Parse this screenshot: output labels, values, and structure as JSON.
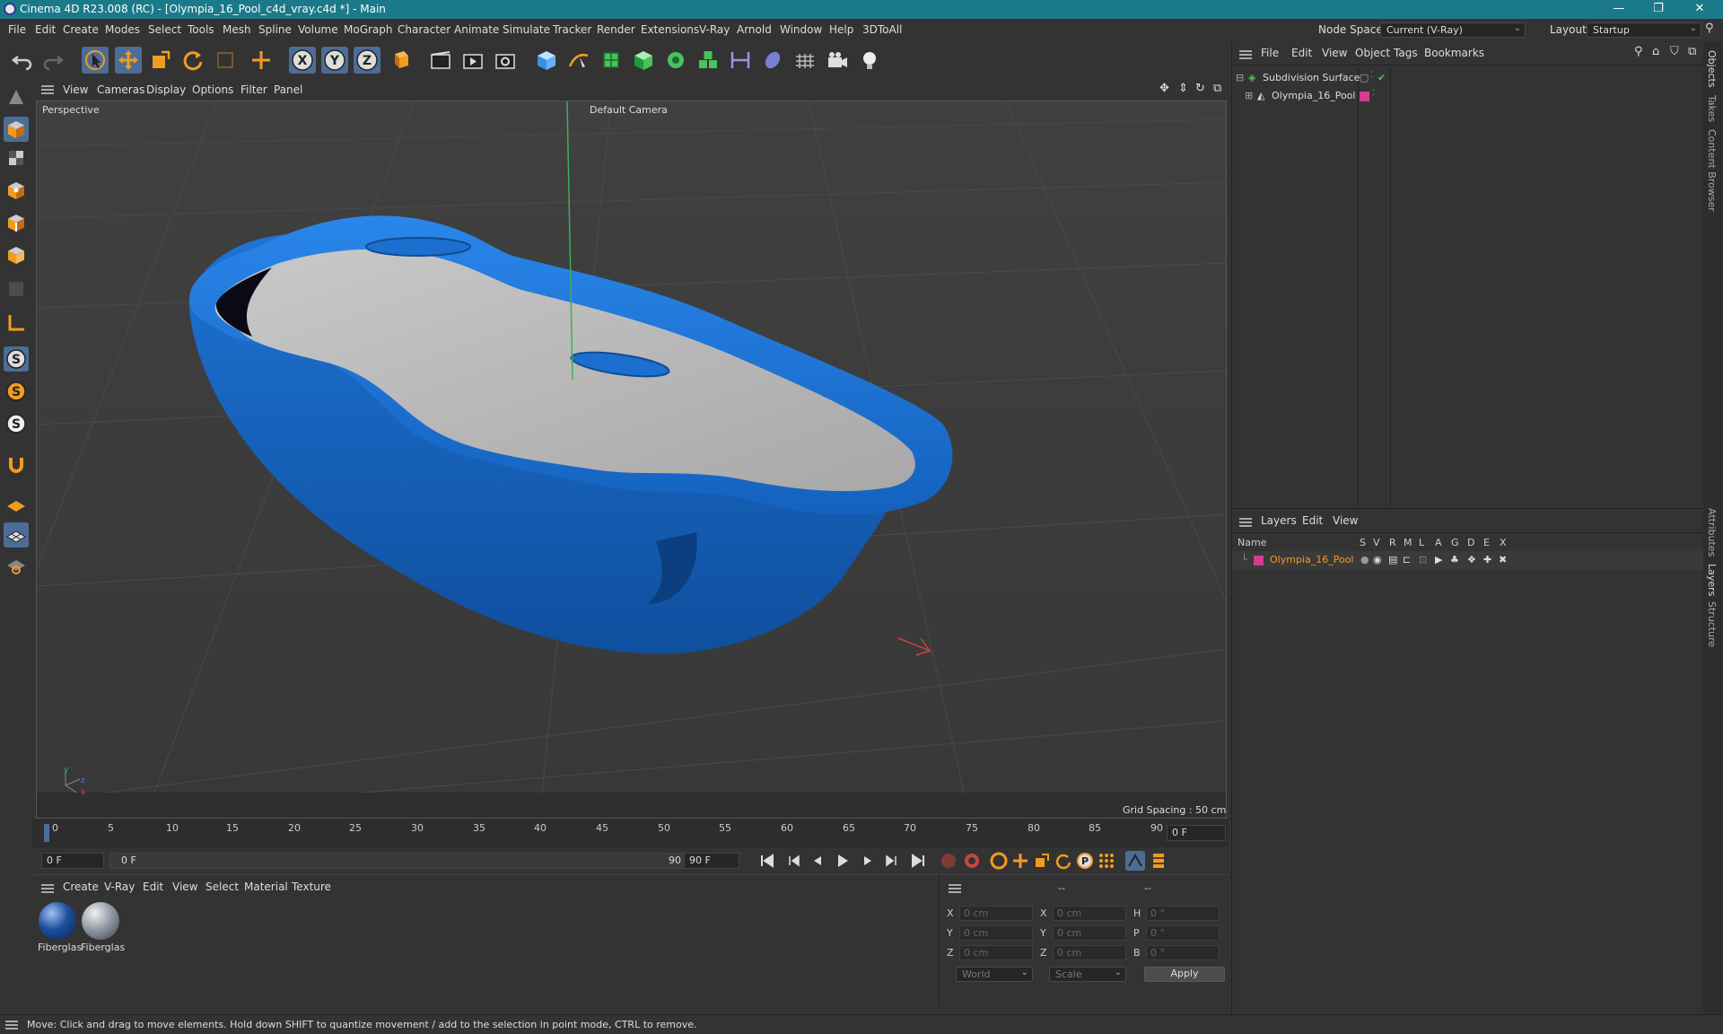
{
  "window": {
    "title": "Cinema 4D R23.008 (RC) - [Olympia_16_Pool_c4d_vray.c4d *] - Main",
    "controls": [
      "—",
      "❐",
      "✕"
    ]
  },
  "menubar": {
    "items": [
      "File",
      "Edit",
      "Create",
      "Modes",
      "Select",
      "Tools",
      "Mesh",
      "Spline",
      "Volume",
      "MoGraph",
      "Character",
      "Animate",
      "Simulate",
      "Tracker",
      "Render",
      "Extensions",
      "V-Ray",
      "Arnold",
      "Window",
      "Help",
      "3DToAll"
    ],
    "node_space_label": "Node Space:",
    "node_space_value": "Current (V-Ray)",
    "layout_label": "Layout:",
    "layout_value": "Startup"
  },
  "viewport": {
    "menu": [
      "View",
      "Cameras",
      "Display",
      "Options",
      "Filter",
      "Panel"
    ],
    "view_name": "Perspective",
    "camera_name": "Default Camera",
    "grid_spacing": "Grid Spacing : 50 cm",
    "axis_labels": {
      "y": "y",
      "z": "z",
      "x": "x"
    }
  },
  "timeline": {
    "ticks": [
      "0",
      "5",
      "10",
      "15",
      "20",
      "25",
      "30",
      "35",
      "40",
      "45",
      "50",
      "55",
      "60",
      "65",
      "70",
      "75",
      "80",
      "85",
      "90"
    ],
    "current_frame_right": "0 F",
    "start_field": "0 F",
    "range_start": "0 F",
    "range_end": "90 F",
    "end_field": "90 F"
  },
  "materials": {
    "menu": [
      "Create",
      "V-Ray",
      "Edit",
      "View",
      "Select",
      "Material",
      "Texture"
    ],
    "items": [
      {
        "label": "Fiberglas",
        "color": "#1d4f9c"
      },
      {
        "label": "Fiberglas",
        "color": "#8a93a0"
      }
    ]
  },
  "attributes": {
    "headers": [
      "--",
      "--",
      "--"
    ],
    "rows": [
      {
        "l1": "X",
        "v1": "0 cm",
        "l2": "X",
        "v2": "0 cm",
        "l3": "H",
        "v3": "0 °"
      },
      {
        "l1": "Y",
        "v1": "0 cm",
        "l2": "Y",
        "v2": "0 cm",
        "l3": "P",
        "v3": "0 °"
      },
      {
        "l1": "Z",
        "v1": "0 cm",
        "l2": "Z",
        "v2": "0 cm",
        "l3": "B",
        "v3": "0 °"
      }
    ],
    "coord_system": "World",
    "mode": "Scale",
    "apply": "Apply"
  },
  "objects_panel": {
    "menu": [
      "File",
      "Edit",
      "View",
      "Object",
      "Tags",
      "Bookmarks"
    ],
    "items": [
      {
        "name": "Subdivision Surface"
      },
      {
        "name": "Olympia_16_Pool"
      }
    ]
  },
  "layers_panel": {
    "menu": [
      "Layers",
      "Edit",
      "View"
    ],
    "columns": [
      "Name",
      "S",
      "V",
      "R",
      "M",
      "L",
      "A",
      "G",
      "D",
      "E",
      "X"
    ],
    "items": [
      {
        "name": "Olympia_16_Pool",
        "color": "#d63c8f"
      }
    ]
  },
  "right_tabs": [
    "Objects",
    "Takes",
    "Content Browser",
    "Attributes",
    "Layers",
    "Structure"
  ],
  "status": "Move: Click and drag to move elements. Hold down SHIFT to quantize movement / add to the selection in point mode, CTRL to remove.",
  "colors": {
    "accent": "#f29b1f",
    "selection": "#4c6d96",
    "titlebar": "#1b7a8a",
    "pool": "#1565c0"
  }
}
